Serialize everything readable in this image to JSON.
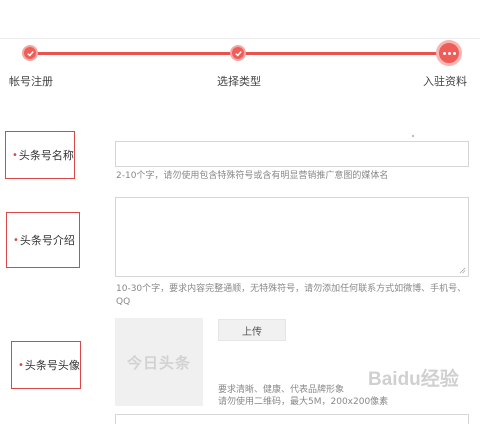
{
  "steps": [
    {
      "label": "帐号注册",
      "state": "done",
      "icon": "check-icon"
    },
    {
      "label": "选择类型",
      "state": "done",
      "icon": "check-icon"
    },
    {
      "label": "入驻资料",
      "state": "current",
      "icon": "more-dots-icon"
    }
  ],
  "fields": {
    "name": {
      "label": "头条号名称",
      "value": "",
      "hint": "2-10个字，请勿使用包含特殊符号或含有明显营销推广意图的媒体名"
    },
    "intro": {
      "label": "头条号介绍",
      "value": "",
      "hint": "10-30个字，要求内容完整通顺，无特殊符号，请勿添加任何联系方式如微博、手机号、QQ"
    },
    "avatar": {
      "label": "头条号头像",
      "placeholder_text": "今日头条",
      "upload_label": "上传",
      "hint_line1": "要求清晰、健康、代表品牌形象",
      "hint_line2": "请勿使用二维码，最大5M，200x200像素"
    }
  },
  "watermark": "Baidu经验",
  "colors": {
    "accent": "#ef5d58",
    "label_border": "#d94848"
  }
}
